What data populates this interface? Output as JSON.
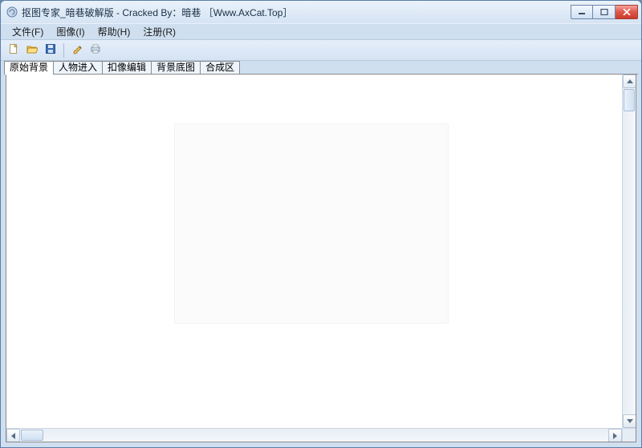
{
  "window": {
    "title": "抠图专家_暗巷破解版 - Cracked By：暗巷 ［Www.AxCat.Top］"
  },
  "menu": {
    "file": "文件(F)",
    "image": "图像(I)",
    "help": "帮助(H)",
    "register": "注册(R)"
  },
  "toolbar_icons": {
    "new": "new-file-icon",
    "open": "open-folder-icon",
    "save": "save-disk-icon",
    "brush": "brush-icon",
    "print": "print-icon"
  },
  "tabs": [
    {
      "id": "original_bg",
      "label": "原始背景",
      "active": true
    },
    {
      "id": "person_import",
      "label": "人物进入",
      "active": false
    },
    {
      "id": "cutout_edit",
      "label": "扣像编辑",
      "active": false
    },
    {
      "id": "bg_base",
      "label": "背景底图",
      "active": false
    },
    {
      "id": "compose",
      "label": "合成区",
      "active": false
    }
  ]
}
